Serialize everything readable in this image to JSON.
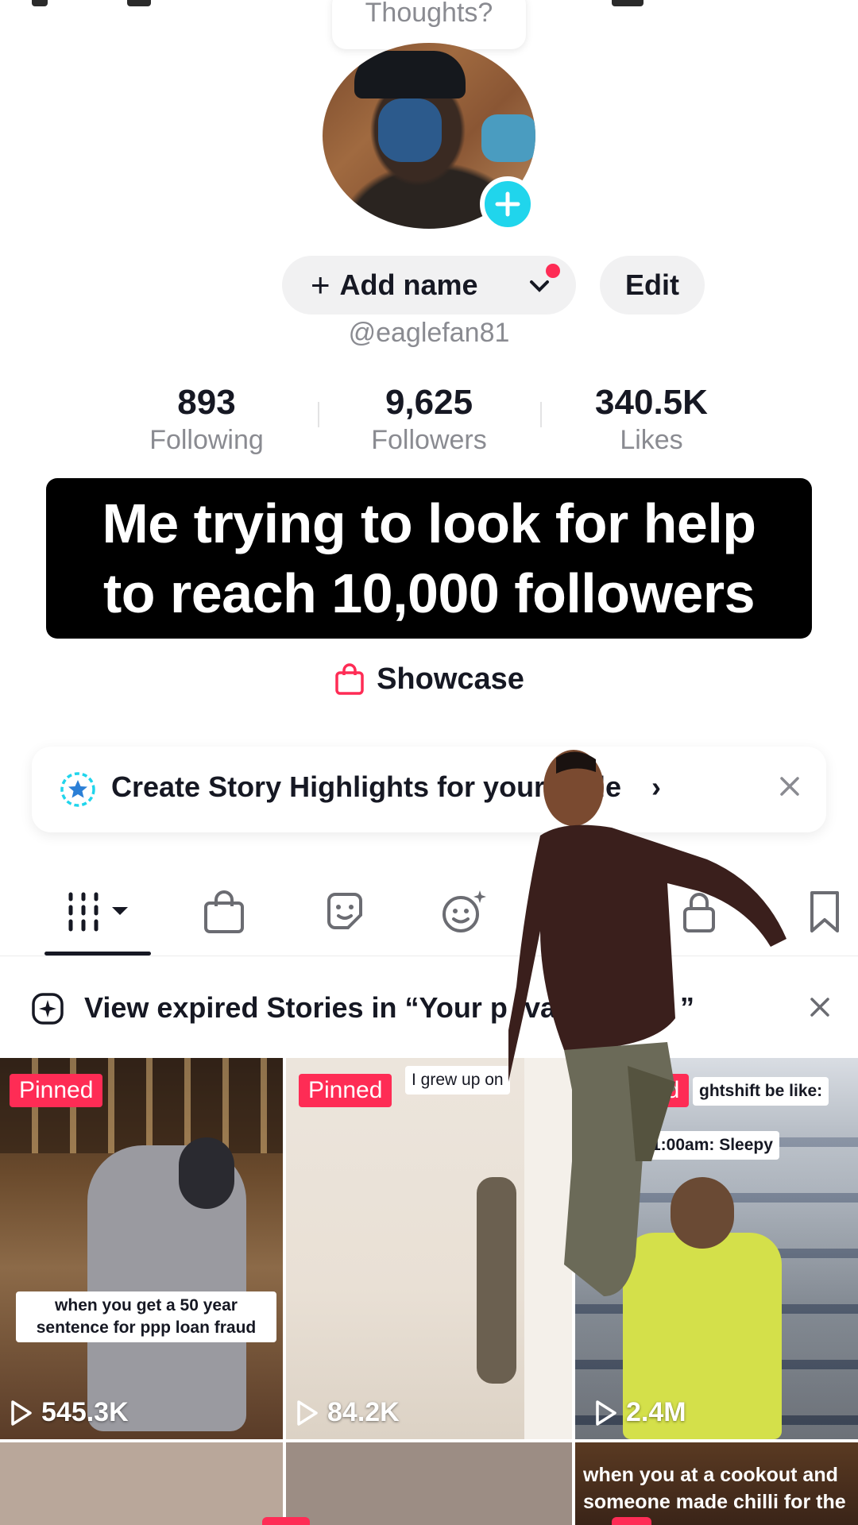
{
  "profile": {
    "thoughts_placeholder": "Thoughts?",
    "add_name_label": "Add name",
    "edit_label": "Edit",
    "handle": "@eaglefan81"
  },
  "stats": [
    {
      "value": "893",
      "label": "Following"
    },
    {
      "value": "9,625",
      "label": "Followers"
    },
    {
      "value": "340.5K",
      "label": "Likes"
    }
  ],
  "caption": {
    "line1": "Me trying to look for help",
    "line2": "to reach 10,000 followers"
  },
  "showcase": {
    "label": "Showcase"
  },
  "highlights_banner": {
    "text": "Create Story Highlights for your",
    "text_end": "file"
  },
  "tabs": {
    "items": [
      "videos-grid",
      "shop",
      "reposts",
      "favorites-effects",
      "private",
      "saved"
    ]
  },
  "expired_banner": {
    "text": "View expired Stories in “Your p",
    "text_mid": "va",
    "text_end": "”"
  },
  "videos": [
    {
      "pinned": "Pinned",
      "caption": "when you get a 50 year sentence for ppp loan fraud",
      "views": "545.3K"
    },
    {
      "pinned": "Pinned",
      "caption": "I grew up on",
      "views": "84.2K"
    },
    {
      "pinned": "ed",
      "caption_top": "ghtshift be like:",
      "caption_mid": "1:00am: Sleepy",
      "views": "2.4M"
    }
  ],
  "row2": {
    "caption": "when you at a cookout and someone made chilli for the"
  },
  "colors": {
    "accent": "#fe2c55",
    "cyan": "#20d5ec",
    "text": "#161823",
    "muted": "#8a8b91"
  }
}
